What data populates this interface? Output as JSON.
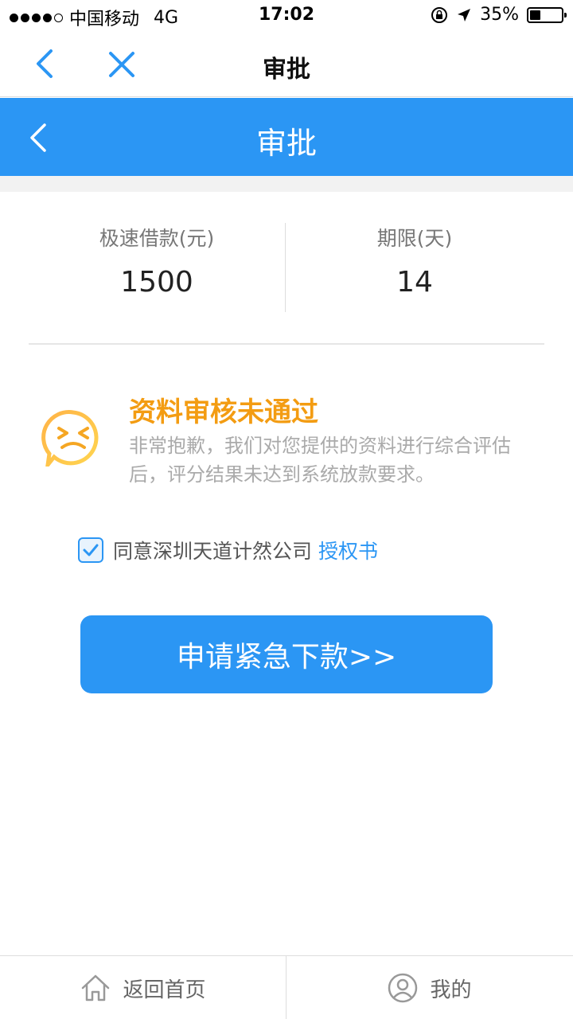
{
  "status_bar": {
    "carrier": "中国移动",
    "network": "4G",
    "time": "17:02",
    "battery": "35%",
    "battery_level": 0.35
  },
  "web_nav": {
    "title": "审批",
    "back_icon": "chevron-left-icon",
    "close_icon": "close-icon"
  },
  "header": {
    "title": "审批",
    "back_icon": "chevron-left-icon"
  },
  "stats": [
    {
      "label": "极速借款(元)",
      "value": "1500"
    },
    {
      "label": "期限(天)",
      "value": "14"
    }
  ],
  "result": {
    "title": "资料审核未通过",
    "description": "非常抱歉，我们对您提供的资料进行综合评估后，评分结果未达到系统放款要求。",
    "icon": "sad-face-icon"
  },
  "agreement": {
    "checked": true,
    "text": "同意深圳天道计然公司",
    "link": "授权书"
  },
  "cta": {
    "label": "申请紧急下款>>"
  },
  "tabs": [
    {
      "label": "返回首页",
      "icon": "home-icon"
    },
    {
      "label": "我的",
      "icon": "user-icon"
    }
  ],
  "colors": {
    "primary": "#2b96f4",
    "warning": "#f39c12",
    "muted": "#aaaaaa"
  }
}
